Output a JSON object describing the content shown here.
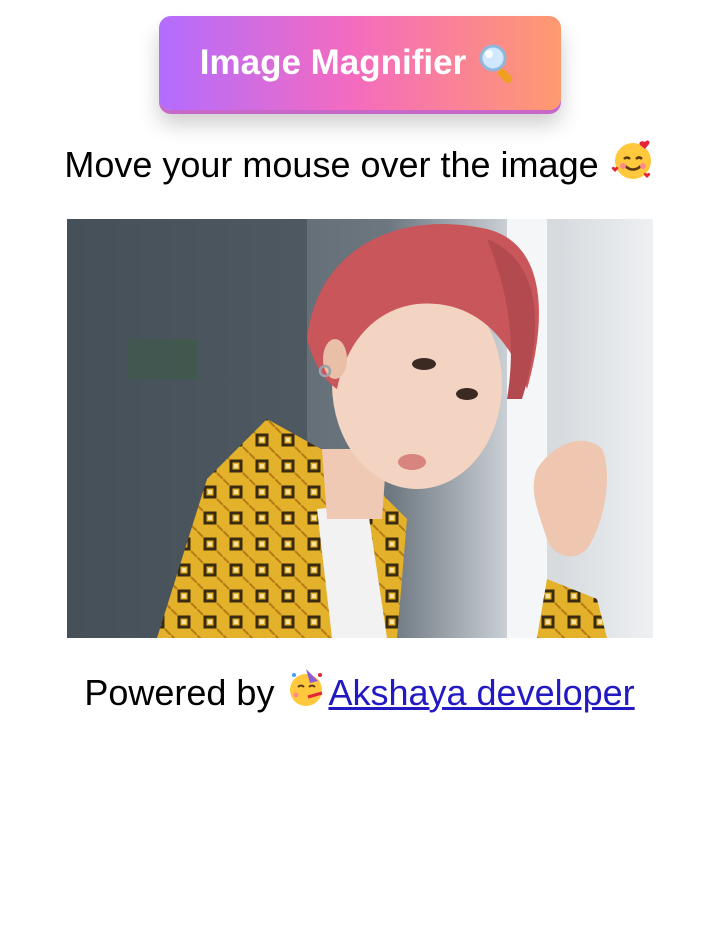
{
  "header": {
    "title": "Image Magnifier",
    "title_icon": "magnifier-icon"
  },
  "subtitle": {
    "text": "Move your mouse over the image",
    "emoji": "smiling-face-with-hearts-icon"
  },
  "image": {
    "description_icon": "portrait-photo"
  },
  "footer": {
    "lead": "Powered by",
    "emoji": "partying-face-icon",
    "link_text": "Akshaya developer"
  },
  "colors": {
    "gradient_start": "#b36cff",
    "gradient_mid": "#f46bbf",
    "gradient_end": "#ff9a6e",
    "link": "#2219c2"
  }
}
